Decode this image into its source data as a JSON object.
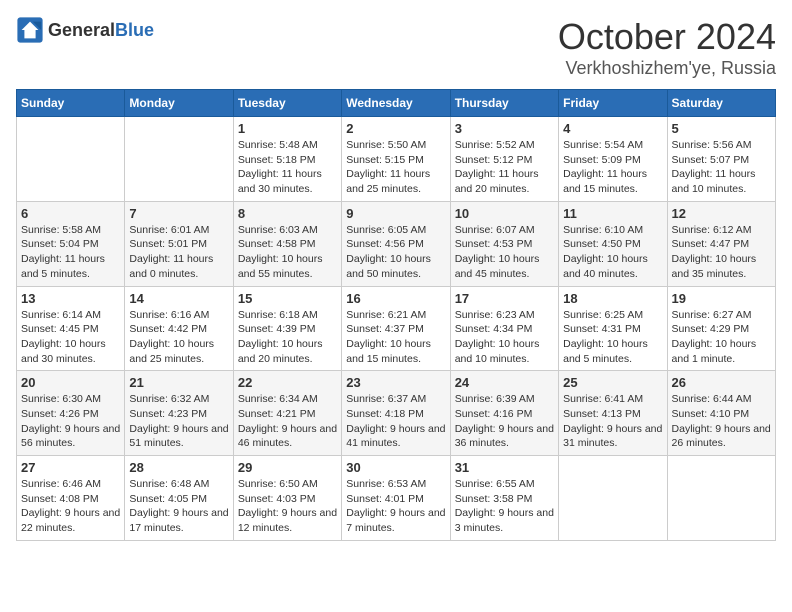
{
  "header": {
    "logo": {
      "text_general": "General",
      "text_blue": "Blue"
    },
    "month": "October 2024",
    "location": "Verkhoshizhem'ye, Russia"
  },
  "weekdays": [
    "Sunday",
    "Monday",
    "Tuesday",
    "Wednesday",
    "Thursday",
    "Friday",
    "Saturday"
  ],
  "weeks": [
    [
      {
        "day": "",
        "info": ""
      },
      {
        "day": "",
        "info": ""
      },
      {
        "day": "1",
        "info": "Sunrise: 5:48 AM\nSunset: 5:18 PM\nDaylight: 11 hours and 30 minutes."
      },
      {
        "day": "2",
        "info": "Sunrise: 5:50 AM\nSunset: 5:15 PM\nDaylight: 11 hours and 25 minutes."
      },
      {
        "day": "3",
        "info": "Sunrise: 5:52 AM\nSunset: 5:12 PM\nDaylight: 11 hours and 20 minutes."
      },
      {
        "day": "4",
        "info": "Sunrise: 5:54 AM\nSunset: 5:09 PM\nDaylight: 11 hours and 15 minutes."
      },
      {
        "day": "5",
        "info": "Sunrise: 5:56 AM\nSunset: 5:07 PM\nDaylight: 11 hours and 10 minutes."
      }
    ],
    [
      {
        "day": "6",
        "info": "Sunrise: 5:58 AM\nSunset: 5:04 PM\nDaylight: 11 hours and 5 minutes."
      },
      {
        "day": "7",
        "info": "Sunrise: 6:01 AM\nSunset: 5:01 PM\nDaylight: 11 hours and 0 minutes."
      },
      {
        "day": "8",
        "info": "Sunrise: 6:03 AM\nSunset: 4:58 PM\nDaylight: 10 hours and 55 minutes."
      },
      {
        "day": "9",
        "info": "Sunrise: 6:05 AM\nSunset: 4:56 PM\nDaylight: 10 hours and 50 minutes."
      },
      {
        "day": "10",
        "info": "Sunrise: 6:07 AM\nSunset: 4:53 PM\nDaylight: 10 hours and 45 minutes."
      },
      {
        "day": "11",
        "info": "Sunrise: 6:10 AM\nSunset: 4:50 PM\nDaylight: 10 hours and 40 minutes."
      },
      {
        "day": "12",
        "info": "Sunrise: 6:12 AM\nSunset: 4:47 PM\nDaylight: 10 hours and 35 minutes."
      }
    ],
    [
      {
        "day": "13",
        "info": "Sunrise: 6:14 AM\nSunset: 4:45 PM\nDaylight: 10 hours and 30 minutes."
      },
      {
        "day": "14",
        "info": "Sunrise: 6:16 AM\nSunset: 4:42 PM\nDaylight: 10 hours and 25 minutes."
      },
      {
        "day": "15",
        "info": "Sunrise: 6:18 AM\nSunset: 4:39 PM\nDaylight: 10 hours and 20 minutes."
      },
      {
        "day": "16",
        "info": "Sunrise: 6:21 AM\nSunset: 4:37 PM\nDaylight: 10 hours and 15 minutes."
      },
      {
        "day": "17",
        "info": "Sunrise: 6:23 AM\nSunset: 4:34 PM\nDaylight: 10 hours and 10 minutes."
      },
      {
        "day": "18",
        "info": "Sunrise: 6:25 AM\nSunset: 4:31 PM\nDaylight: 10 hours and 5 minutes."
      },
      {
        "day": "19",
        "info": "Sunrise: 6:27 AM\nSunset: 4:29 PM\nDaylight: 10 hours and 1 minute."
      }
    ],
    [
      {
        "day": "20",
        "info": "Sunrise: 6:30 AM\nSunset: 4:26 PM\nDaylight: 9 hours and 56 minutes."
      },
      {
        "day": "21",
        "info": "Sunrise: 6:32 AM\nSunset: 4:23 PM\nDaylight: 9 hours and 51 minutes."
      },
      {
        "day": "22",
        "info": "Sunrise: 6:34 AM\nSunset: 4:21 PM\nDaylight: 9 hours and 46 minutes."
      },
      {
        "day": "23",
        "info": "Sunrise: 6:37 AM\nSunset: 4:18 PM\nDaylight: 9 hours and 41 minutes."
      },
      {
        "day": "24",
        "info": "Sunrise: 6:39 AM\nSunset: 4:16 PM\nDaylight: 9 hours and 36 minutes."
      },
      {
        "day": "25",
        "info": "Sunrise: 6:41 AM\nSunset: 4:13 PM\nDaylight: 9 hours and 31 minutes."
      },
      {
        "day": "26",
        "info": "Sunrise: 6:44 AM\nSunset: 4:10 PM\nDaylight: 9 hours and 26 minutes."
      }
    ],
    [
      {
        "day": "27",
        "info": "Sunrise: 6:46 AM\nSunset: 4:08 PM\nDaylight: 9 hours and 22 minutes."
      },
      {
        "day": "28",
        "info": "Sunrise: 6:48 AM\nSunset: 4:05 PM\nDaylight: 9 hours and 17 minutes."
      },
      {
        "day": "29",
        "info": "Sunrise: 6:50 AM\nSunset: 4:03 PM\nDaylight: 9 hours and 12 minutes."
      },
      {
        "day": "30",
        "info": "Sunrise: 6:53 AM\nSunset: 4:01 PM\nDaylight: 9 hours and 7 minutes."
      },
      {
        "day": "31",
        "info": "Sunrise: 6:55 AM\nSunset: 3:58 PM\nDaylight: 9 hours and 3 minutes."
      },
      {
        "day": "",
        "info": ""
      },
      {
        "day": "",
        "info": ""
      }
    ]
  ]
}
